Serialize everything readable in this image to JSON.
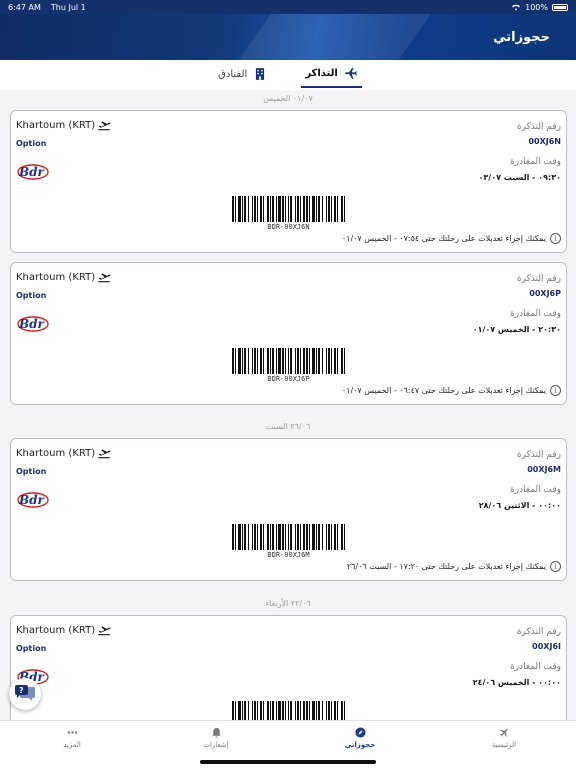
{
  "status_bar": {
    "time": "6:47 AM",
    "date": "Thu Jul 1",
    "battery": "100%"
  },
  "header": {
    "title": "حجوزاتي"
  },
  "tabs": [
    {
      "label": "التذاكر",
      "icon": "plane-icon",
      "active": true
    },
    {
      "label": "الفنادق",
      "icon": "hotel-icon",
      "active": false
    }
  ],
  "groups": [
    {
      "date": "٠١/٠٧ الخميس"
    },
    {
      "date": "٢٦/٠٦ السبت"
    },
    {
      "date": "٢٣/٠٦ الأربعاء"
    }
  ],
  "tickets": [
    {
      "destination": "Khartoum (KRT)",
      "option": "Option",
      "ticket_label": "رقم التذكرة",
      "ticket_no": "00XJ6N",
      "departure_label": "وقت المغادرة",
      "departure": "٠٩:٣٠ - السبت ٠٣/٠٧",
      "barcode": "BDR-00XJ6N",
      "notice": "يمكنك إجراء تعديلات على رحلتك حتى ٠٧:٥٤ - الخميس ٠١/٠٧"
    },
    {
      "destination": "Khartoum (KRT)",
      "option": "Option",
      "ticket_label": "رقم التذكرة",
      "ticket_no": "00XJ6P",
      "departure_label": "وقت المغادرة",
      "departure": "٢٠:٣٠ - الخميس ٠١/٠٧",
      "barcode": "BDR-00XJ6P",
      "notice": "يمكنك إجراء تعديلات على رحلتك حتى ٠٦:٤٧ - الخميس ٠١/٠٧"
    },
    {
      "destination": "Khartoum (KRT)",
      "option": "Option",
      "ticket_label": "رقم التذكرة",
      "ticket_no": "00XJ6M",
      "departure_label": "وقت المغادرة",
      "departure": "٠٠:٠٠ - الاثنين ٢٨/٠٦",
      "barcode": "BDR-00XJ6M",
      "notice": "يمكنك إجراء تعديلات على رحلتك حتى ١٧:٢٠ - السبت ٢٦/٠٦"
    },
    {
      "destination": "Khartoum (KRT)",
      "option": "Option",
      "ticket_label": "رقم التذكرة",
      "ticket_no": "00XJ6I",
      "departure_label": "وقت المغادرة",
      "departure": "٠٠:٠٠ - الخميس ٢٤/٠٦"
    }
  ],
  "bottom_nav": [
    {
      "label": "المزيد",
      "icon": "more-icon"
    },
    {
      "label": "إشعارات",
      "icon": "bell-icon"
    },
    {
      "label": "حجوزاتي",
      "icon": "compass-icon",
      "active": true
    },
    {
      "label": "الرئيسية",
      "icon": "plane-icon"
    }
  ],
  "colors": {
    "primary": "#16316b",
    "accent": "#1c56ad",
    "background": "#f4f4f6"
  }
}
